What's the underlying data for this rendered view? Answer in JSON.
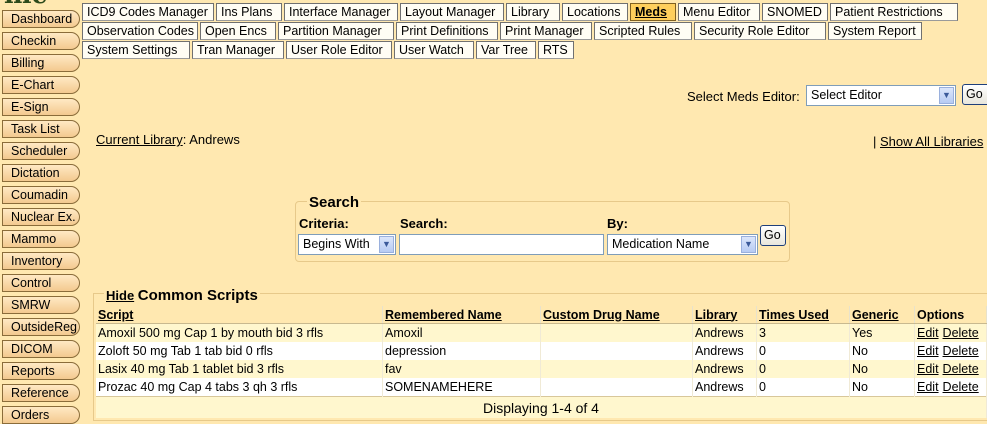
{
  "app": {
    "logo_text": "mc"
  },
  "sidebar": {
    "items": [
      {
        "label": "Dashboard"
      },
      {
        "label": "Checkin"
      },
      {
        "label": "Billing"
      },
      {
        "label": "E-Chart"
      },
      {
        "label": "E-Sign"
      },
      {
        "label": "Task List"
      },
      {
        "label": "Scheduler"
      },
      {
        "label": "Dictation"
      },
      {
        "label": "Coumadin"
      },
      {
        "label": "Nuclear Ex."
      },
      {
        "label": "Mammo"
      },
      {
        "label": "Inventory"
      },
      {
        "label": "Control"
      },
      {
        "label": "SMRW"
      },
      {
        "label": "OutsideReg"
      },
      {
        "label": "DICOM"
      },
      {
        "label": "Reports"
      },
      {
        "label": "Reference"
      },
      {
        "label": "Orders"
      }
    ]
  },
  "tabs": {
    "row1": [
      "ICD9 Codes Manager",
      "Ins Plans",
      "Interface Manager",
      "Layout Manager",
      "Library",
      "Locations",
      "Meds",
      "Menu Editor",
      "SNOMED",
      "Patient Restrictions"
    ],
    "row2": [
      "Observation Codes",
      "Open Encs",
      "Partition Manager",
      "Print Definitions",
      "Print Manager",
      "Scripted Rules",
      "Security Role Editor",
      "System Report"
    ],
    "row3": [
      "System Settings",
      "Tran Manager",
      "User Role Editor",
      "User Watch",
      "Var Tree",
      "RTS"
    ],
    "active": "Meds"
  },
  "editor": {
    "label": "Select Meds Editor:",
    "selected": "Select Editor",
    "go": "Go"
  },
  "library": {
    "label": "Current Library",
    "colon": ":",
    "value": "Andrews",
    "separator": "|",
    "show_all": "Show All Libraries"
  },
  "search": {
    "title": "Search",
    "criteria_label": "Criteria:",
    "criteria_value": "Begins With",
    "search_label": "Search:",
    "search_value": "",
    "by_label": "By:",
    "by_value": "Medication Name",
    "go": "Go"
  },
  "scripts": {
    "hide_label": "Hide",
    "title": "Common Scripts",
    "columns": [
      "Script",
      "Remembered Name",
      "Custom Drug Name",
      "Library",
      "Times Used",
      "Generic",
      "Options"
    ],
    "rows": [
      {
        "script": "Amoxil 500 mg Cap 1 by mouth bid 3 rfls",
        "remembered": "Amoxil",
        "custom": "",
        "library": "Andrews",
        "times": "3",
        "generic": "Yes",
        "edit": "Edit",
        "delete": "Delete"
      },
      {
        "script": "Zoloft 50 mg Tab 1 tab bid 0 rfls",
        "remembered": "depression",
        "custom": "",
        "library": "Andrews",
        "times": "0",
        "generic": "No",
        "edit": "Edit",
        "delete": "Delete"
      },
      {
        "script": "Lasix 40 mg Tab 1 tablet bid 3 rfls",
        "remembered": "fav",
        "custom": "",
        "library": "Andrews",
        "times": "0",
        "generic": "No",
        "edit": "Edit",
        "delete": "Delete"
      },
      {
        "script": "Prozac 40 mg Cap 4 tabs 3 qh 3 rfls",
        "remembered": "SOMENAMEHERE",
        "custom": "",
        "library": "Andrews",
        "times": "0",
        "generic": "No",
        "edit": "Edit",
        "delete": "Delete"
      }
    ],
    "footer": "Displaying 1-4 of 4"
  }
}
